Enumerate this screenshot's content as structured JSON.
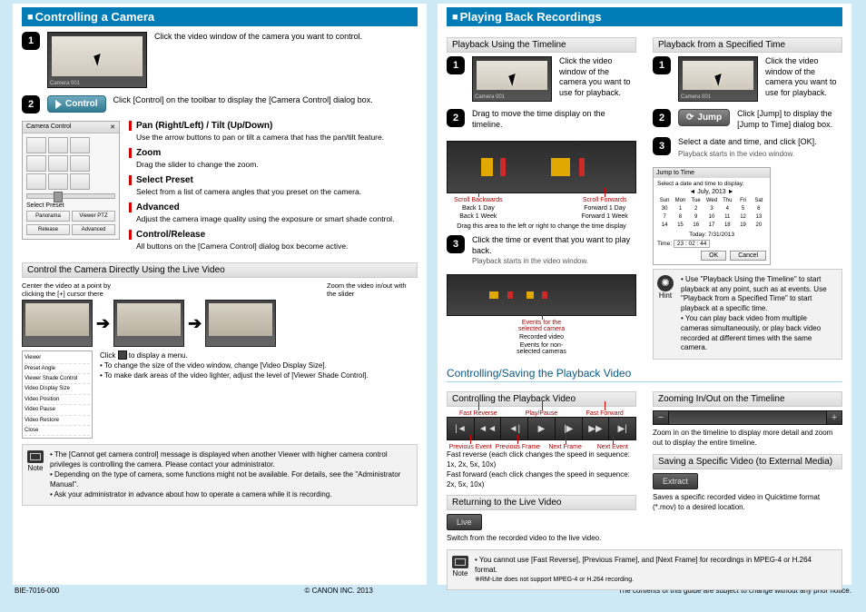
{
  "page1": {
    "title": "Controlling a Camera",
    "step1": "Click the video window of the camera you want to control.",
    "step2_pre": "Click [Control] on the toolbar to display the [Camera Control] dialog box.",
    "control_label": "Control",
    "panel_title": "Camera Control",
    "preset_label": "Select Preset",
    "preset_opts": [
      "Panorama",
      "Viewer PTZ",
      "Advanced"
    ],
    "feat": [
      {
        "h": "Pan (Right/Left) / Tilt (Up/Down)",
        "p": "Use the arrow buttons to pan or tilt a camera that has the pan/tilt feature."
      },
      {
        "h": "Zoom",
        "p": "Drag the slider to change the zoom."
      },
      {
        "h": "Select Preset",
        "p": "Select from a list of camera angles that you preset on the camera."
      },
      {
        "h": "Advanced",
        "p": "Adjust the camera image quality using the exposure or smart shade control."
      },
      {
        "h": "Control/Release",
        "p": "All buttons on the [Camera Control] dialog box become active."
      }
    ],
    "sub1": "Control the Camera Directly Using the Live Video",
    "cap_left": "Center the video at a point by clicking the [+] cursor there",
    "cap_right": "Zoom the video in/out with the slider",
    "menu_hint_pre": "Click ",
    "menu_hint_post": " to display a menu.",
    "menu_bullets": [
      "To change the size of the video window, change [Video Display Size].",
      "To make dark areas of the video lighter, adjust the level of [Viewer Shade Control]."
    ],
    "menu_items": [
      "Viewer",
      "Preset Angle",
      "Viewer Shade Control",
      "Video Display Size",
      "Video Position",
      "Video Pause",
      "Video Restore",
      "Close"
    ],
    "note_label": "Note",
    "notes": [
      "The [Cannot get camera control] message is displayed when another Viewer with higher camera control privileges is controlling the camera. Please contact your administrator.",
      "Depending on the type of camera, some functions might not be available. For details, see the \"Administrator Manual\".",
      "Ask your administrator in advance about how to operate a camera while it is recording."
    ]
  },
  "page2": {
    "title": "Playing Back Recordings",
    "secA": "Playback Using the Timeline",
    "secB": "Playback from a Specified Time",
    "a1": "Click the video window of the camera you want to use for playback.",
    "a2": "Drag to move the time display on the timeline.",
    "a3": "Click the time or event that you want to play back.",
    "a3_sub": "Playback starts in the video window.",
    "tl_labels_top": [
      "Scroll Backwards",
      "",
      "Scroll Forwards"
    ],
    "tl_labels_mid": [
      "Back 1 Day",
      "",
      "Forward 1 Day"
    ],
    "tl_labels_bot": [
      "Back 1 Week",
      "",
      "Forward 1 Week"
    ],
    "tl_drag": "Drag this area to the left or right to change the time display",
    "ev_sel": "Events for the selected camera",
    "ev_rec": "Recorded video",
    "ev_non": "Events for non-selected cameras",
    "b1": "Click the video window of the camera you want to use for playback.",
    "b2": "Click [Jump] to display the [Jump to Time] dialog box.",
    "jump_label": "Jump",
    "b3": "Select a date and time, and click [OK].",
    "b3_sub": "Playback starts in the video window.",
    "cal_title": "Jump to Time",
    "cal_hint": "Select a date and time to display.",
    "cal_month": "July, 2013",
    "cal_days": [
      "Sun",
      "Mon",
      "Tue",
      "Wed",
      "Thu",
      "Fri",
      "Sat"
    ],
    "cal_today": "Today: 7/31/2013",
    "cal_time_lbl": "Time:",
    "cal_time": "23 : 02 : 44",
    "cal_ok": "OK",
    "cal_cancel": "Cancel",
    "hint_label": "Hint",
    "hints": [
      "Use \"Playback Using the Timeline\" to start playback at any point, such as at events. Use \"Playback from a Specified Time\" to start playback at a specific time.",
      "You can play back video from multiple cameras simultaneously, or play back video recorded at different times with the same camera."
    ],
    "sec2": "Controlling/Saving the Playback Video",
    "subC1": "Controlling the Playback Video",
    "pb_labels_top": [
      "Fast Reverse",
      "Play/Pause",
      "Fast Forward"
    ],
    "pb_labels_bot": [
      "Previous Event",
      "Previous Frame",
      "Next Frame",
      "Next Event"
    ],
    "pb_note1": "Fast reverse (each click changes the speed in sequence: 1x, 2x, 5x, 10x)",
    "pb_note2": "Fast forward (each click changes the speed in sequence: 2x, 5x, 10x)",
    "subC2": "Returning to the Live Video",
    "live_btn": "Live",
    "live_txt": "Switch from the recorded video to the live video.",
    "subD1": "Zooming In/Out on the Timeline",
    "zoom_txt": "Zoom in on the timeline to display more detail and zoom out to display the entire timeline.",
    "subD2": "Saving a Specific Video (to External Media)",
    "extract_btn": "Extract",
    "extract_txt": "Saves a specific recorded video in Quicktime format (*.mov) to a desired location.",
    "bottom_note": "You cannot use [Fast Reverse], [Previous Frame], and [Next Frame] for recordings in MPEG-4 or H.264 format.",
    "bottom_note2": "RM-Lite does not support MPEG-4 or H.264 recording."
  },
  "foot": {
    "l": "BIE-7016-000",
    "c": "© CANON INC. 2013",
    "r": "The contents of this guide are subject to change without any prior notice."
  }
}
